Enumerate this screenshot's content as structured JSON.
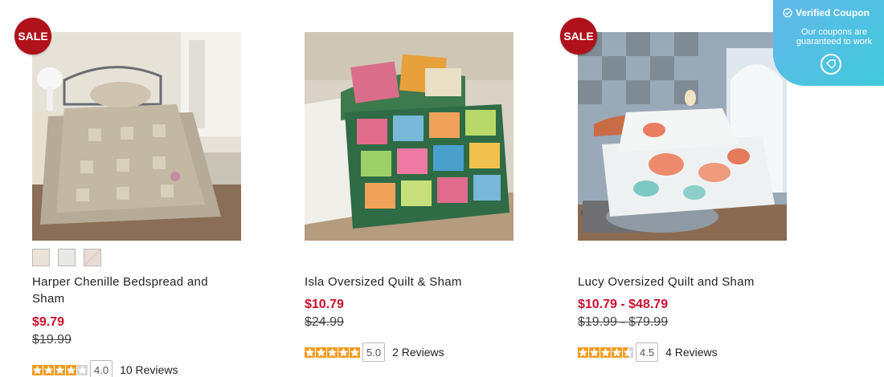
{
  "products": [
    {
      "sale_badge": "SALE",
      "name": "Harper Chenille Bedspread and Sham",
      "price": "$9.79",
      "original_price": "$19.99",
      "rating": "4.0",
      "stars_filled": 4,
      "reviews": "10 Reviews",
      "swatches": [
        "#ebe3d7",
        "#e8e8e6",
        "#e9dcd6"
      ]
    },
    {
      "name": "Isla Oversized Quilt & Sham",
      "price": "$10.79",
      "original_price": "$24.99",
      "rating": "5.0",
      "stars_filled": 5,
      "reviews": "2 Reviews"
    },
    {
      "sale_badge": "SALE",
      "name": "Lucy Oversized Quilt and Sham",
      "price": "$10.79 - $48.79",
      "original_price": "$19.99 - $79.99",
      "rating": "4.5",
      "stars_filled": 4.5,
      "reviews": "4 Reviews"
    }
  ],
  "coupon_widget": {
    "title": "Verified Coupon",
    "subtitle": "Our coupons are guaranteed to work"
  },
  "colors": {
    "sale_red": "#b0121b",
    "price_red": "#c8102e",
    "star_orange": "#f39a1d",
    "coupon_blue": "#4fc3e0"
  }
}
